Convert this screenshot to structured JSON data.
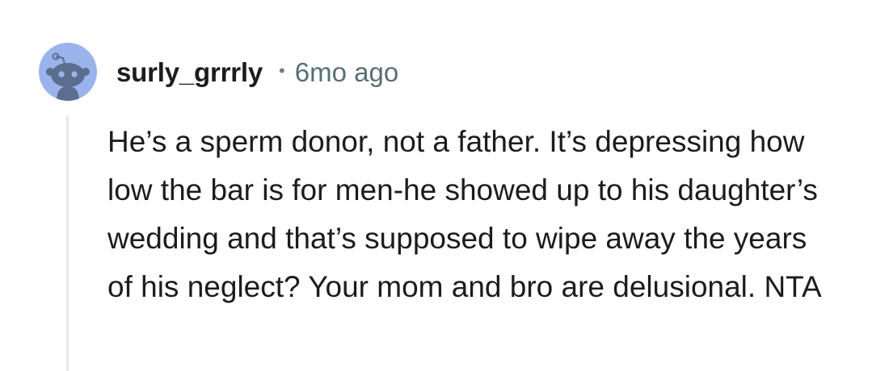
{
  "comment": {
    "username": "surly_grrrly",
    "separator": "•",
    "timestamp": "6mo ago",
    "body": "He’s a sperm donor, not a father. It’s depressing how low the bar is for men-he showed up to his daughter’s wedding and that’s supposed to wipe away the years of his neglect? Your mom and bro are delusional. NTA",
    "avatar_icon": "snoo-avatar-icon",
    "avatar_color": "#9bb3ec"
  }
}
